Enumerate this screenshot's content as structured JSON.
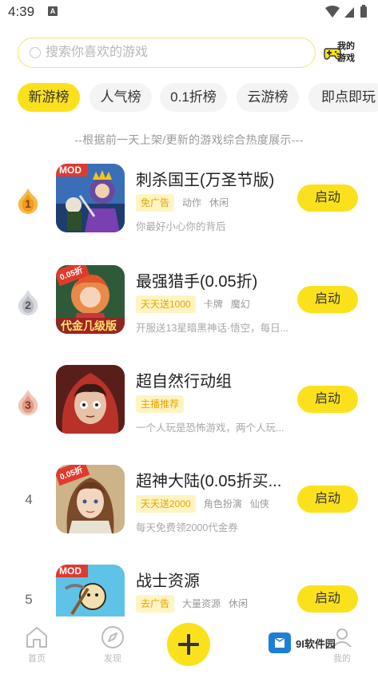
{
  "status_bar": {
    "time": "4:39",
    "notification": "A"
  },
  "search": {
    "placeholder": "搜索你喜欢的游戏"
  },
  "my_games": {
    "label_line1": "我的",
    "label_line2": "游戏"
  },
  "tabs": [
    {
      "label": "新游榜",
      "active": true
    },
    {
      "label": "人气榜",
      "active": false
    },
    {
      "label": "0.1折榜",
      "active": false
    },
    {
      "label": "云游榜",
      "active": false
    },
    {
      "label": "即点即玩",
      "active": false
    }
  ],
  "hint": "--根据前一天上架/更新的游戏综合热度展示---",
  "games": [
    {
      "rank": "1",
      "title": "刺杀国王(万圣节版)",
      "highlight_tag": "免广告",
      "tags": [
        "动作",
        "休闲"
      ],
      "desc": "你最好小心你的背后",
      "button": "启动",
      "badge": "MOD"
    },
    {
      "rank": "2",
      "title": "最强猎手(0.05折)",
      "highlight_tag": "天天送1000",
      "tags": [
        "卡牌",
        "魔幻"
      ],
      "desc": "开服送13星暗黑神话·悟空，每日...",
      "button": "启动",
      "badge": "0.05折",
      "overlay": "代金几级版"
    },
    {
      "rank": "3",
      "title": "超自然行动组",
      "highlight_tag": "主播推荐",
      "tags": [],
      "desc": "一个人玩是恐怖游戏，两个人玩...",
      "button": "启动"
    },
    {
      "rank": "4",
      "title": "超神大陆(0.05折买...",
      "highlight_tag": "天天送2000",
      "tags": [
        "角色扮演",
        "仙侠"
      ],
      "desc": "每天免费领2000代金券",
      "button": "启动",
      "badge": "0.05折"
    },
    {
      "rank": "5",
      "title": "战士资源",
      "highlight_tag": "去广告",
      "tags": [
        "大量资源",
        "休闲"
      ],
      "desc": "",
      "button": "启动",
      "badge": "MOD"
    }
  ],
  "bottom_nav": {
    "home": "首页",
    "discover": "发现",
    "mine": "我的"
  },
  "watermark": "9I软件园",
  "colors": {
    "accent": "#fbe11c",
    "highlight_tag_text": "#e8a300",
    "highlight_tag_bg": "#fff4c2"
  }
}
